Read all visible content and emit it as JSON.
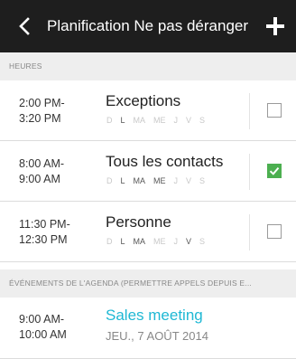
{
  "header": {
    "title": "Planification Ne pas déranger",
    "back_icon": "chevron-left-icon",
    "add_icon": "plus-icon"
  },
  "sections": {
    "hours_label": "HEURES",
    "events_label": "ÉVÉNEMENTS DE L'AGENDA (PERMETTRE APPELS DEPUIS E..."
  },
  "schedules": [
    {
      "start": "2:00 PM-",
      "end": "3:20 PM",
      "name": "Exceptions",
      "days": [
        "D",
        "L",
        "MA",
        "ME",
        "J",
        "V",
        "S"
      ],
      "active_days": [
        false,
        true,
        false,
        false,
        false,
        false,
        false
      ],
      "checked": false
    },
    {
      "start": "8:00 AM-",
      "end": "9:00 AM",
      "name": "Tous les contacts",
      "days": [
        "D",
        "L",
        "MA",
        "ME",
        "J",
        "V",
        "S"
      ],
      "active_days": [
        false,
        true,
        true,
        true,
        false,
        false,
        false
      ],
      "checked": true
    },
    {
      "start": "11:30 PM-",
      "end": "12:30 PM",
      "name": "Personne",
      "days": [
        "D",
        "L",
        "MA",
        "ME",
        "J",
        "V",
        "S"
      ],
      "active_days": [
        false,
        true,
        true,
        false,
        false,
        true,
        false
      ],
      "checked": false
    }
  ],
  "event": {
    "start": "9:00 AM-",
    "end": "10:00 AM",
    "title": "Sales meeting",
    "date": "JEU., 7 AOÛT 2014"
  },
  "colors": {
    "topbar": "#1e1e1e",
    "check_green": "#4caf50",
    "event_accent": "#1fb8d4"
  }
}
